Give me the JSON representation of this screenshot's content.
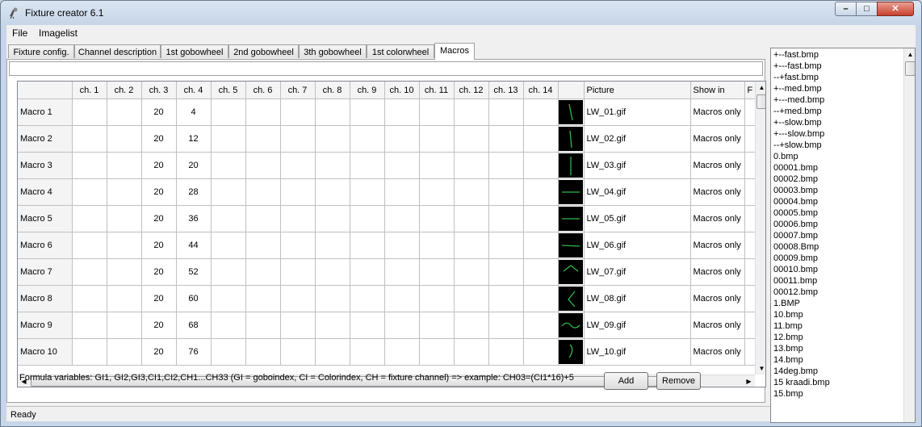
{
  "window": {
    "title": "Fixture creator 6.1"
  },
  "menubar": {
    "items": [
      "File",
      "Imagelist"
    ]
  },
  "tabs": [
    "Fixture config.",
    "Channel description",
    "1st gobowheel",
    "2nd gobowheel",
    "3th gobowheel",
    "1st colorwheel",
    "Macros"
  ],
  "active_tab": "Macros",
  "grid": {
    "columns": [
      "",
      "ch. 1",
      "ch. 2",
      "ch. 3",
      "ch. 4",
      "ch. 5",
      "ch. 6",
      "ch. 7",
      "ch. 8",
      "ch. 9",
      "ch. 10",
      "ch. 11",
      "ch. 12",
      "ch. 13",
      "ch. 14",
      "",
      "Picture",
      "Show in",
      "F"
    ],
    "rows": [
      {
        "name": "Macro 1",
        "ch3": "20",
        "ch4": "4",
        "picture": "LW_01.gif",
        "show_in": "Macros only"
      },
      {
        "name": "Macro 2",
        "ch3": "20",
        "ch4": "12",
        "picture": "LW_02.gif",
        "show_in": "Macros only"
      },
      {
        "name": "Macro 3",
        "ch3": "20",
        "ch4": "20",
        "picture": "LW_03.gif",
        "show_in": "Macros only"
      },
      {
        "name": "Macro 4",
        "ch3": "20",
        "ch4": "28",
        "picture": "LW_04.gif",
        "show_in": "Macros only"
      },
      {
        "name": "Macro 5",
        "ch3": "20",
        "ch4": "36",
        "picture": "LW_05.gif",
        "show_in": "Macros only"
      },
      {
        "name": "Macro 6",
        "ch3": "20",
        "ch4": "44",
        "picture": "LW_06.gif",
        "show_in": "Macros only"
      },
      {
        "name": "Macro 7",
        "ch3": "20",
        "ch4": "52",
        "picture": "LW_07.gif",
        "show_in": "Macros only"
      },
      {
        "name": "Macro 8",
        "ch3": "20",
        "ch4": "60",
        "picture": "LW_08.gif",
        "show_in": "Macros only"
      },
      {
        "name": "Macro 9",
        "ch3": "20",
        "ch4": "68",
        "picture": "LW_09.gif",
        "show_in": "Macros only"
      },
      {
        "name": "Macro 10",
        "ch3": "20",
        "ch4": "76",
        "picture": "LW_10.gif",
        "show_in": "Macros only"
      }
    ]
  },
  "formula_text": "Formula variables: GI1, GI2,GI3,CI1,CI2,CH1...CH33 (GI = goboindex, CI = Colorindex, CH = fixture channel)  => example: CH03=(CI1*16)+5",
  "buttons": {
    "add": "Add",
    "remove": "Remove"
  },
  "file_list": [
    "+--fast.bmp",
    "+---fast.bmp",
    "--+fast.bmp",
    "+--med.bmp",
    "+---med.bmp",
    "--+med.bmp",
    "+--slow.bmp",
    "+---slow.bmp",
    "--+slow.bmp",
    "0.bmp",
    "00001.bmp",
    "00002.bmp",
    "00003.bmp",
    "00004.bmp",
    "00005.bmp",
    "00006.bmp",
    "00007.bmp",
    "00008.Bmp",
    "00009.bmp",
    "00010.bmp",
    "00011.bmp",
    "00012.bmp",
    "1.BMP",
    "10.bmp",
    "11.bmp",
    "12.bmp",
    "13.bmp",
    "14.bmp",
    "14deg.bmp",
    "15 kraadi.bmp",
    "15.bmp"
  ],
  "status": "Ready",
  "colors": {
    "thumb_line": "#2fb84a",
    "thumb_bg": "#000000"
  },
  "icons": {
    "window": [
      "minimize-icon",
      "maximize-icon",
      "close-icon"
    ],
    "scroll": [
      "arrow-up-icon",
      "arrow-down-icon",
      "arrow-left-icon",
      "arrow-right-icon"
    ]
  }
}
